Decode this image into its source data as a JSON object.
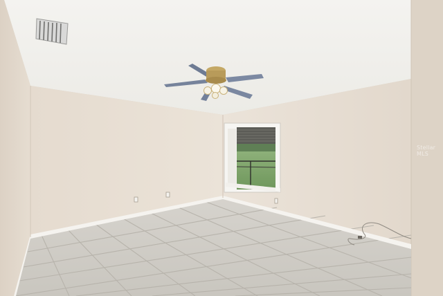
{
  "scene": {
    "description_label": "empty-room-photo",
    "colors": {
      "ceiling": "#f2f1ed",
      "wall_left": "#e6ddd2",
      "wall_back": "#e9e1d6",
      "wall_right": "#e4dacf",
      "near_wall": "#ddd3c7",
      "floor": "#cfccc6",
      "grout": "#b9b5ae",
      "baseboard": "#f4f2ee",
      "fan_blade": "#7d8aa3",
      "fan_brass": "#b89b5a",
      "window_grass": "#7fa36b",
      "window_sky": "#dfe6ea",
      "blind": "#5a5a55"
    }
  },
  "watermark": {
    "text": "Stellar MLS"
  }
}
